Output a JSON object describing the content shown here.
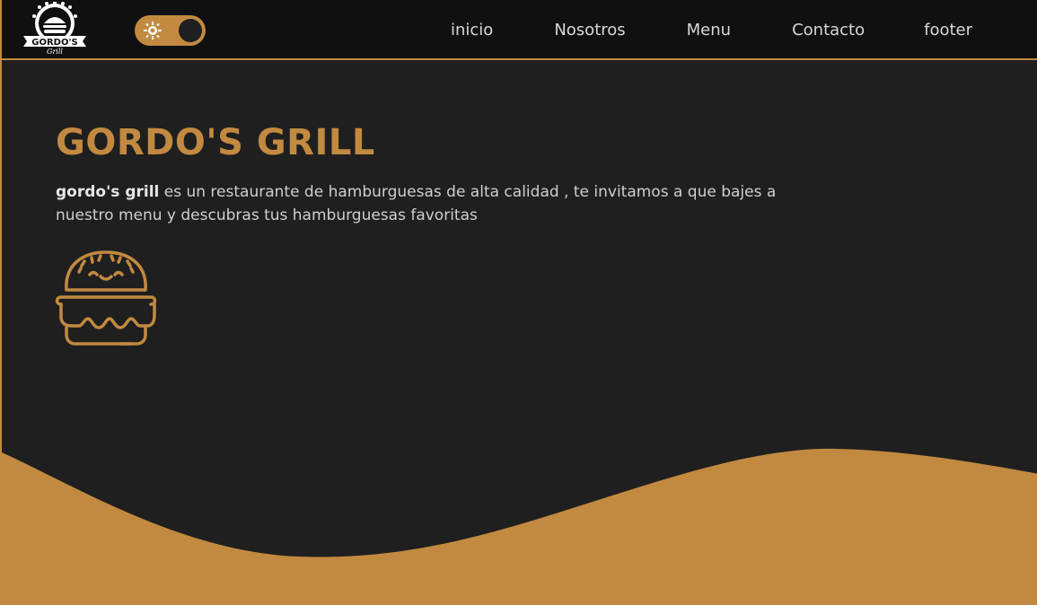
{
  "brand": {
    "logo_icon": "gordos-grill-logo",
    "logo_text_top": "GORDO'S",
    "logo_text_bottom": "Grill",
    "accent_color": "#c28a40",
    "background_color": "#1f1f1f",
    "navbar_color": "#101010"
  },
  "theme_toggle": {
    "icon": "sun-icon",
    "state": "light-mode-off"
  },
  "nav": {
    "items": [
      {
        "label": "inicio"
      },
      {
        "label": "Nosotros"
      },
      {
        "label": "Menu"
      },
      {
        "label": "Contacto"
      },
      {
        "label": "footer"
      }
    ]
  },
  "hero": {
    "title": "GORDO'S GRILL",
    "brand_bold": "gordo's grill",
    "description": " es un restaurante de hamburguesas de alta calidad , te invitamos a que bajes a nuestro menu y descubras tus hamburguesas favoritas",
    "icon": "burger-icon"
  }
}
